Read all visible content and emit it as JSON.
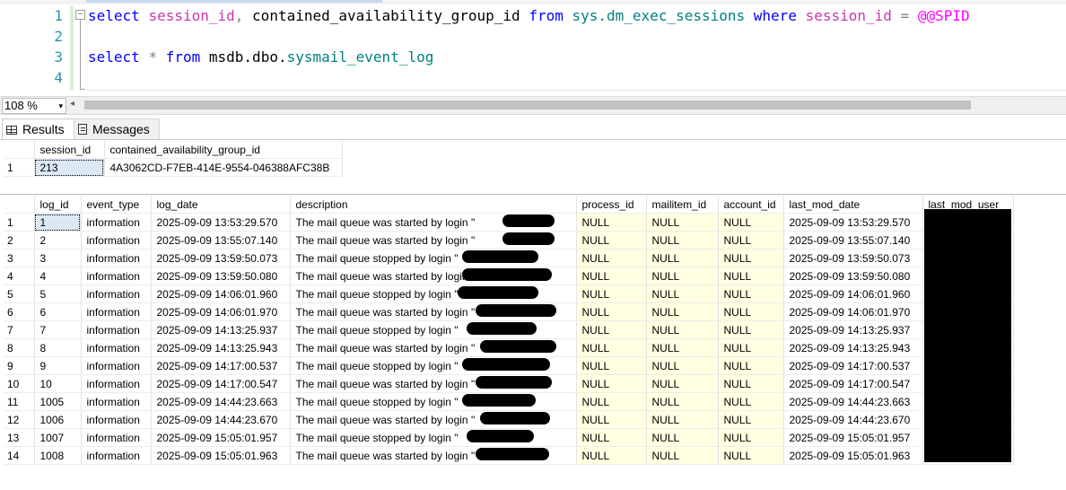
{
  "editor": {
    "line_numbers": [
      "1",
      "2",
      "3",
      "4"
    ],
    "line1": {
      "kw_select": "select",
      "col1": "session_id",
      "comma": ",",
      "col2": "contained_availability_group_id",
      "kw_from": "from",
      "table": "sys.dm_exec_sessions",
      "kw_where": "where",
      "col3": "session_id",
      "eq": "=",
      "var": "@@SPID"
    },
    "line3": {
      "kw_select": "select",
      "star": "*",
      "kw_from": "from",
      "db": "msdb.dbo.",
      "table": "sysmail_event_log"
    },
    "collapse_glyph": "−"
  },
  "zoom": {
    "value": "108 %",
    "arrow": "▾",
    "scroll_left": "◂"
  },
  "tabs": {
    "results": "Results",
    "messages": "Messages"
  },
  "grid1": {
    "columns": [
      "",
      "session_id",
      "contained_availability_group_id"
    ],
    "rows": [
      [
        "1",
        "213",
        "4A3062CD-F7EB-414E-9554-046388AFC38B"
      ]
    ]
  },
  "grid2": {
    "columns": [
      "",
      "log_id",
      "event_type",
      "log_date",
      "description",
      "process_id",
      "mailitem_id",
      "account_id",
      "last_mod_date",
      "last_mod_user"
    ],
    "rows": [
      [
        "1",
        "1",
        "information",
        "2025-09-09 13:53:29.570",
        "The mail queue was started by login \"",
        "NULL",
        "NULL",
        "NULL",
        "2025-09-09 13:53:29.570",
        ""
      ],
      [
        "2",
        "2",
        "information",
        "2025-09-09 13:55:07.140",
        "The mail queue was started by login \"",
        "NULL",
        "NULL",
        "NULL",
        "2025-09-09 13:55:07.140",
        ""
      ],
      [
        "3",
        "3",
        "information",
        "2025-09-09 13:59:50.073",
        "The mail queue stopped by login \"",
        "NULL",
        "NULL",
        "NULL",
        "2025-09-09 13:59:50.073",
        ""
      ],
      [
        "4",
        "4",
        "information",
        "2025-09-09 13:59:50.080",
        "The mail queue was started by login \"",
        "NULL",
        "NULL",
        "NULL",
        "2025-09-09 13:59:50.080",
        ""
      ],
      [
        "5",
        "5",
        "information",
        "2025-09-09 14:06:01.960",
        "The mail queue stopped by login \"",
        "NULL",
        "NULL",
        "NULL",
        "2025-09-09 14:06:01.960",
        ""
      ],
      [
        "6",
        "6",
        "information",
        "2025-09-09 14:06:01.970",
        "The mail queue was started by login \"",
        "NULL",
        "NULL",
        "NULL",
        "2025-09-09 14:06:01.970",
        ""
      ],
      [
        "7",
        "7",
        "information",
        "2025-09-09 14:13:25.937",
        "The mail queue stopped by login \"",
        "NULL",
        "NULL",
        "NULL",
        "2025-09-09 14:13:25.937",
        ""
      ],
      [
        "8",
        "8",
        "information",
        "2025-09-09 14:13:25.943",
        "The mail queue was started by login \"",
        "NULL",
        "NULL",
        "NULL",
        "2025-09-09 14:13:25.943",
        ""
      ],
      [
        "9",
        "9",
        "information",
        "2025-09-09 14:17:00.537",
        "The mail queue stopped by login \"",
        "NULL",
        "NULL",
        "NULL",
        "2025-09-09 14:17:00.537",
        ""
      ],
      [
        "10",
        "10",
        "information",
        "2025-09-09 14:17:00.547",
        "The mail queue was started by login \"",
        "NULL",
        "NULL",
        "NULL",
        "2025-09-09 14:17:00.547",
        ""
      ],
      [
        "11",
        "1005",
        "information",
        "2025-09-09 14:44:23.663",
        "The mail queue stopped by login \"",
        "NULL",
        "NULL",
        "NULL",
        "2025-09-09 14:44:23.663",
        ""
      ],
      [
        "12",
        "1006",
        "information",
        "2025-09-09 14:44:23.670",
        "The mail queue was started by login \"",
        "NULL",
        "NULL",
        "NULL",
        "2025-09-09 14:44:23.670",
        ""
      ],
      [
        "13",
        "1007",
        "information",
        "2025-09-09 15:05:01.957",
        "The mail queue stopped by login \"",
        "NULL",
        "NULL",
        "NULL",
        "2025-09-09 15:05:01.957",
        ""
      ],
      [
        "14",
        "1008",
        "information",
        "2025-09-09 15:05:01.963",
        "The mail queue was started by login \"",
        "NULL",
        "NULL",
        "NULL",
        "2025-09-09 15:05:01.963",
        ""
      ]
    ]
  }
}
